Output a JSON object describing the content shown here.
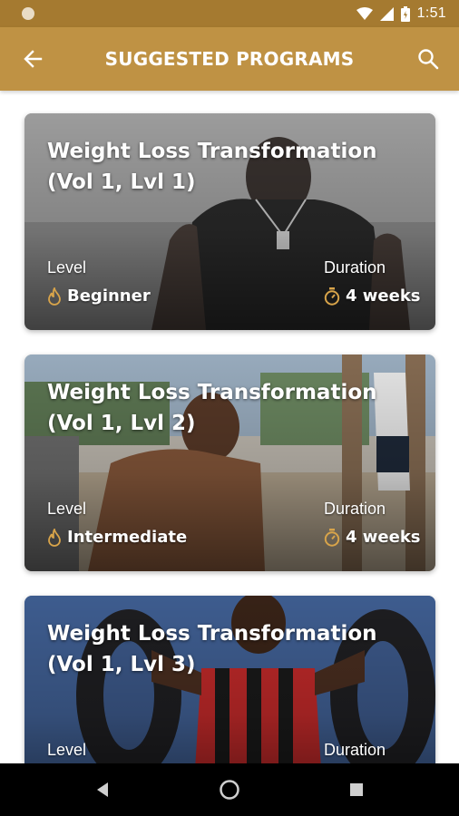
{
  "status_bar": {
    "time": "1:51"
  },
  "app_bar": {
    "title": "SUGGESTED PROGRAMS"
  },
  "colors": {
    "brand": "#bf9244",
    "brand_dark": "#a57a30",
    "icon_gold": "#d8a44a"
  },
  "programs": [
    {
      "title": "Weight Loss Transformation (Vol 1, Lvl 1)",
      "level_label": "Level",
      "level": "Beginner",
      "duration_label": "Duration",
      "duration": "4 weeks"
    },
    {
      "title": "Weight Loss Transformation (Vol 1, Lvl 2)",
      "level_label": "Level",
      "level": "Intermediate",
      "duration_label": "Duration",
      "duration": "4 weeks"
    },
    {
      "title": "Weight Loss Transformation (Vol 1, Lvl 3)",
      "level_label": "Level",
      "level": "",
      "duration_label": "Duration",
      "duration": ""
    }
  ],
  "icons": {
    "back": "arrow-left-icon",
    "search": "search-icon",
    "level": "flame-icon",
    "duration": "stopwatch-icon",
    "nav_back": "triangle-back-icon",
    "nav_home": "circle-home-icon",
    "nav_recents": "square-recents-icon"
  }
}
